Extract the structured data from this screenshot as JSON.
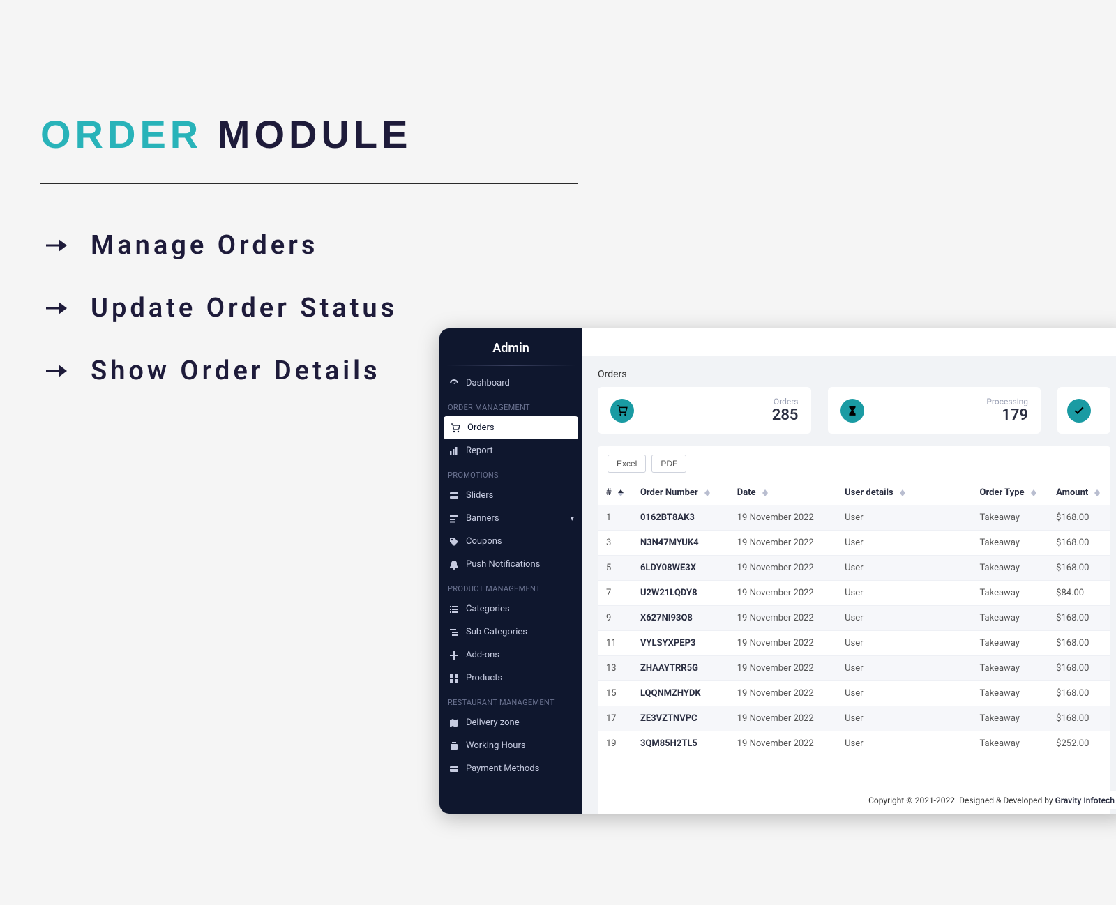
{
  "slide": {
    "title_part1": "ORDER",
    "title_part2": " MODULE",
    "bullets": [
      "Manage Orders",
      "Update Order Status",
      "Show Order Details"
    ]
  },
  "sidebar": {
    "title": "Admin",
    "sections": [
      {
        "label": "",
        "items": [
          {
            "icon": "gauge",
            "label": "Dashboard",
            "active": false
          }
        ]
      },
      {
        "label": "ORDER MANAGEMENT",
        "items": [
          {
            "icon": "cart",
            "label": "Orders",
            "active": true
          },
          {
            "icon": "barchart",
            "label": "Report",
            "active": false
          }
        ]
      },
      {
        "label": "PROMOTIONS",
        "items": [
          {
            "icon": "sliders",
            "label": "Sliders",
            "active": false
          },
          {
            "icon": "banners",
            "label": "Banners",
            "active": false,
            "expandable": true
          },
          {
            "icon": "tag",
            "label": "Coupons",
            "active": false
          },
          {
            "icon": "bell",
            "label": "Push Notifications",
            "active": false
          }
        ]
      },
      {
        "label": "PRODUCT MANAGEMENT",
        "items": [
          {
            "icon": "list",
            "label": "Categories",
            "active": false
          },
          {
            "icon": "sublist",
            "label": "Sub Categories",
            "active": false
          },
          {
            "icon": "plus",
            "label": "Add-ons",
            "active": false
          },
          {
            "icon": "grid",
            "label": "Products",
            "active": false
          }
        ]
      },
      {
        "label": "RESTAURANT MANAGEMENT",
        "items": [
          {
            "icon": "map",
            "label": "Delivery zone",
            "active": false
          },
          {
            "icon": "clock",
            "label": "Working Hours",
            "active": false
          },
          {
            "icon": "card",
            "label": "Payment Methods",
            "active": false
          }
        ]
      }
    ]
  },
  "page": {
    "title": "Orders"
  },
  "stats": [
    {
      "icon": "cart",
      "label": "Orders",
      "value": "285"
    },
    {
      "icon": "hourglass",
      "label": "Processing",
      "value": "179"
    },
    {
      "icon": "check",
      "label": "",
      "value": ""
    }
  ],
  "export": {
    "excel": "Excel",
    "pdf": "PDF"
  },
  "table": {
    "columns": [
      "#",
      "Order Number",
      "Date",
      "User details",
      "Order Type",
      "Amount"
    ],
    "rows": [
      {
        "idx": "1",
        "num": "0162BT8AK3",
        "date": "19 November 2022",
        "user": "User",
        "type": "Takeaway",
        "amount": "$168.00"
      },
      {
        "idx": "3",
        "num": "N3N47MYUK4",
        "date": "19 November 2022",
        "user": "User",
        "type": "Takeaway",
        "amount": "$168.00"
      },
      {
        "idx": "5",
        "num": "6LDY08WE3X",
        "date": "19 November 2022",
        "user": "User",
        "type": "Takeaway",
        "amount": "$168.00"
      },
      {
        "idx": "7",
        "num": "U2W21LQDY8",
        "date": "19 November 2022",
        "user": "User",
        "type": "Takeaway",
        "amount": "$84.00"
      },
      {
        "idx": "9",
        "num": "X627NI93Q8",
        "date": "19 November 2022",
        "user": "User",
        "type": "Takeaway",
        "amount": "$168.00"
      },
      {
        "idx": "11",
        "num": "VYLSYXPEP3",
        "date": "19 November 2022",
        "user": "User",
        "type": "Takeaway",
        "amount": "$168.00"
      },
      {
        "idx": "13",
        "num": "ZHAAYTRR5G",
        "date": "19 November 2022",
        "user": "User",
        "type": "Takeaway",
        "amount": "$168.00"
      },
      {
        "idx": "15",
        "num": "LQQNMZHYDK",
        "date": "19 November 2022",
        "user": "User",
        "type": "Takeaway",
        "amount": "$168.00"
      },
      {
        "idx": "17",
        "num": "ZE3VZTNVPC",
        "date": "19 November 2022",
        "user": "User",
        "type": "Takeaway",
        "amount": "$168.00"
      },
      {
        "idx": "19",
        "num": "3QM85H2TL5",
        "date": "19 November 2022",
        "user": "User",
        "type": "Takeaway",
        "amount": "$252.00"
      }
    ]
  },
  "footer": {
    "text": "Copyright © 2021-2022. Designed & Developed by ",
    "link": "Gravity Infotech"
  }
}
